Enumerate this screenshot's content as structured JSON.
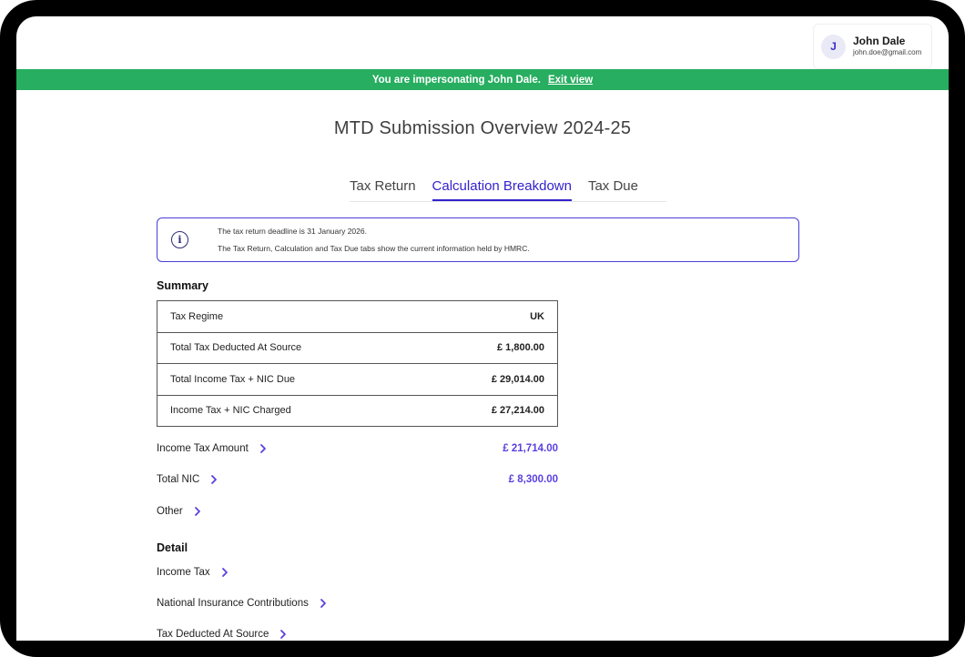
{
  "user": {
    "initial": "J",
    "name": "John Dale",
    "email": "john.doe@gmail.com"
  },
  "banner": {
    "message": "You are impersonating John Dale.",
    "exit_label": "Exit view",
    "color": "#27ae60"
  },
  "page_title": "MTD Submission Overview 2024-25",
  "tabs": [
    {
      "label": "Tax Return",
      "active": false
    },
    {
      "label": "Calculation Breakdown",
      "active": true
    },
    {
      "label": "Tax Due",
      "active": false
    }
  ],
  "info": {
    "icon": "info-icon",
    "line1": "The tax return deadline is 31 January 2026.",
    "line2": "The Tax Return, Calculation and Tax Due tabs show the current information held by HMRC."
  },
  "summary": {
    "title": "Summary",
    "rows": [
      {
        "label": "Tax Regime",
        "value": "UK"
      },
      {
        "label": "Total Tax Deducted At Source",
        "value": "£ 1,800.00"
      },
      {
        "label": "Total Income Tax + NIC Due",
        "value": "£ 29,014.00"
      },
      {
        "label": "Income Tax + NIC Charged",
        "value": "£ 27,214.00"
      }
    ],
    "links": [
      {
        "label": "Income Tax Amount",
        "amount": "£ 21,714.00"
      },
      {
        "label": "Total NIC",
        "amount": "£ 8,300.00"
      },
      {
        "label": "Other",
        "amount": ""
      }
    ]
  },
  "detail": {
    "title": "Detail",
    "links": [
      {
        "label": "Income Tax"
      },
      {
        "label": "National Insurance Contributions"
      },
      {
        "label": "Tax Deducted At Source"
      }
    ]
  },
  "colors": {
    "accent": "#3322cc",
    "amount": "#5a3fe0",
    "chevron": "#5a3fe0"
  }
}
